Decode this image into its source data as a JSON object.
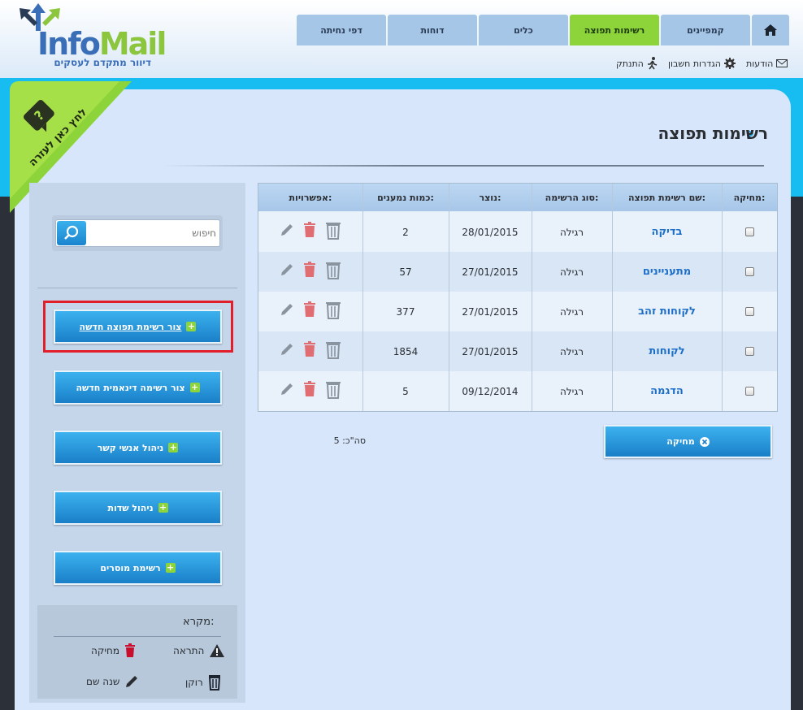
{
  "logo": {
    "info": "Info",
    "mail": "Mail",
    "tagline": "דיוור מתקדם לעסקים"
  },
  "nav": {
    "tabs": [
      {
        "label": "דפי נחיתה"
      },
      {
        "label": "דוחות"
      },
      {
        "label": "כלים"
      },
      {
        "label": "רשימות תפוצה"
      },
      {
        "label": "קמפיינים"
      }
    ],
    "active_tab": "רשימות תפוצה"
  },
  "util": {
    "messages": "הודעות",
    "account_settings": "הגדרות חשבון",
    "logout": "התנתק"
  },
  "help": {
    "label": "לחץ כאן לעזרה",
    "badge": "?"
  },
  "page": {
    "title": "רשימות תפוצה"
  },
  "search": {
    "placeholder": "חיפוש"
  },
  "sidebar": {
    "buttons": [
      {
        "label": "צור רשימת תפוצה חדשה"
      },
      {
        "label": "צור רשימה דינאמית חדשה"
      },
      {
        "label": "ניהול אנשי קשר"
      },
      {
        "label": "ניהול שדות"
      },
      {
        "label": "רשימת מוסרים"
      }
    ]
  },
  "legend": {
    "title": "מקרא:",
    "items": [
      {
        "label": "התראה",
        "icon": "warning-icon"
      },
      {
        "label": "מחיקה",
        "icon": "trash-icon"
      },
      {
        "label": "רוקן",
        "icon": "empty-bin-icon"
      },
      {
        "label": "שנה שם",
        "icon": "pencil-icon"
      }
    ]
  },
  "table": {
    "headers": {
      "delete": "מחיקה:",
      "name": "שם רשימת תפוצה:",
      "type": "סוג הרשימה:",
      "created": "נוצר:",
      "count": "כמות נמענים:",
      "options": "אפשרויות:"
    },
    "rows": [
      {
        "name": "בדיקה",
        "type": "רגילה",
        "created": "28/01/2015",
        "count": "2"
      },
      {
        "name": "מתעניינים",
        "type": "רגילה",
        "created": "27/01/2015",
        "count": "57"
      },
      {
        "name": "לקוחות זהב",
        "type": "רגילה",
        "created": "27/01/2015",
        "count": "377"
      },
      {
        "name": "לקוחות",
        "type": "רגילה",
        "created": "27/01/2015",
        "count": "1854"
      },
      {
        "name": "הדגמה",
        "type": "רגילה",
        "created": "09/12/2014",
        "count": "5"
      }
    ]
  },
  "actions": {
    "delete_label": "מחיקה",
    "total_label": "סה\"כ: 5"
  },
  "colors": {
    "accent_blue": "#1a7fc8",
    "active_green": "#8cd43a",
    "link_blue": "#1d6fc8",
    "highlight_red": "#e21e2a"
  }
}
